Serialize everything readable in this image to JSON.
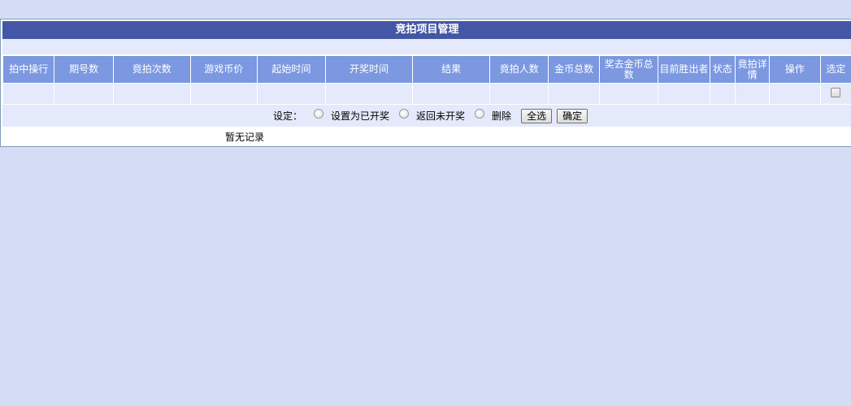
{
  "panel": {
    "title": "竞拍项目管理"
  },
  "table": {
    "columns": [
      "拍中操行",
      "期号数",
      "竟拍次数",
      "游戏币价",
      "起始时间",
      "开奖时间",
      "结果",
      "竟拍人数",
      "金币总数",
      "奖去金币总数",
      "目前胜出者",
      "状态",
      "竟拍详情",
      "操作",
      "选定"
    ]
  },
  "settings": {
    "label": "设定：",
    "options": [
      "设置为已开奖",
      "返回未开奖",
      "删除"
    ],
    "select_all_button": "全选",
    "confirm_button": "确定"
  },
  "empty_message": "暂无记录",
  "colors": {
    "page_background": "#d5ddf6",
    "title_bar": "#4357a6",
    "header_cells": "#7b98e0",
    "body_cells": "#e4e9fb"
  }
}
